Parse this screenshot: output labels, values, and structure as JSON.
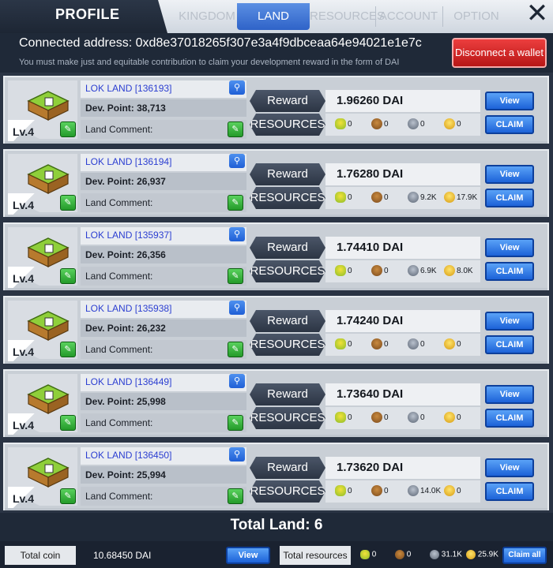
{
  "nav": {
    "profile": "PROFILE",
    "tabs": [
      "KINGDOM",
      "LAND",
      "RESOURCES",
      "ACCOUNT",
      "OPTION"
    ],
    "active_tab": "LAND",
    "close": "✕"
  },
  "header": {
    "connected": "Connected address: 0xd8e37018265f307e3a4f9dbceaa64e94021e1e7c",
    "note": "You must make just and equitable contribution to claim your development reward in the form of DAI",
    "disconnect_label": "Disconnect a wallet"
  },
  "labels": {
    "reward": "Reward",
    "resources": "RESOURCES",
    "view": "View",
    "claim": "CLAIM",
    "land_comment": "Land Comment:"
  },
  "lands": [
    {
      "level": "Lv.4",
      "name": "LOK LAND [136193]",
      "dev_point": "Dev. Point: 38,713",
      "reward": "1.96260 DAI",
      "corn": "0",
      "wood": "0",
      "stone": "0",
      "gold": "0"
    },
    {
      "level": "Lv.4",
      "name": "LOK LAND [136194]",
      "dev_point": "Dev. Point: 26,937",
      "reward": "1.76280 DAI",
      "corn": "0",
      "wood": "0",
      "stone": "9.2K",
      "gold": "17.9K"
    },
    {
      "level": "Lv.4",
      "name": "LOK LAND [135937]",
      "dev_point": "Dev. Point: 26,356",
      "reward": "1.74410 DAI",
      "corn": "0",
      "wood": "0",
      "stone": "6.9K",
      "gold": "8.0K"
    },
    {
      "level": "Lv.4",
      "name": "LOK LAND [135938]",
      "dev_point": "Dev. Point: 26,232",
      "reward": "1.74240 DAI",
      "corn": "0",
      "wood": "0",
      "stone": "0",
      "gold": "0"
    },
    {
      "level": "Lv.4",
      "name": "LOK LAND [136449]",
      "dev_point": "Dev. Point: 25,998",
      "reward": "1.73640 DAI",
      "corn": "0",
      "wood": "0",
      "stone": "0",
      "gold": "0"
    },
    {
      "level": "Lv.4",
      "name": "LOK LAND [136450]",
      "dev_point": "Dev. Point: 25,994",
      "reward": "1.73620 DAI",
      "corn": "0",
      "wood": "0",
      "stone": "14.0K",
      "gold": "0"
    }
  ],
  "total_land": "Total Land: 6",
  "footer": {
    "total_coin_label": "Total coin",
    "total_coin_value": "10.68450 DAI",
    "view_label": "View",
    "total_resources_label": "Total resources",
    "corn": "0",
    "wood": "0",
    "stone": "31.1K",
    "gold": "25.9K",
    "claim_all_label": "Claim all"
  },
  "colors": {
    "accent_blue": "#2f63c8",
    "disconnect_red": "#d42828",
    "edit_green": "#36b23c",
    "dark_bg": "#1f2938"
  }
}
